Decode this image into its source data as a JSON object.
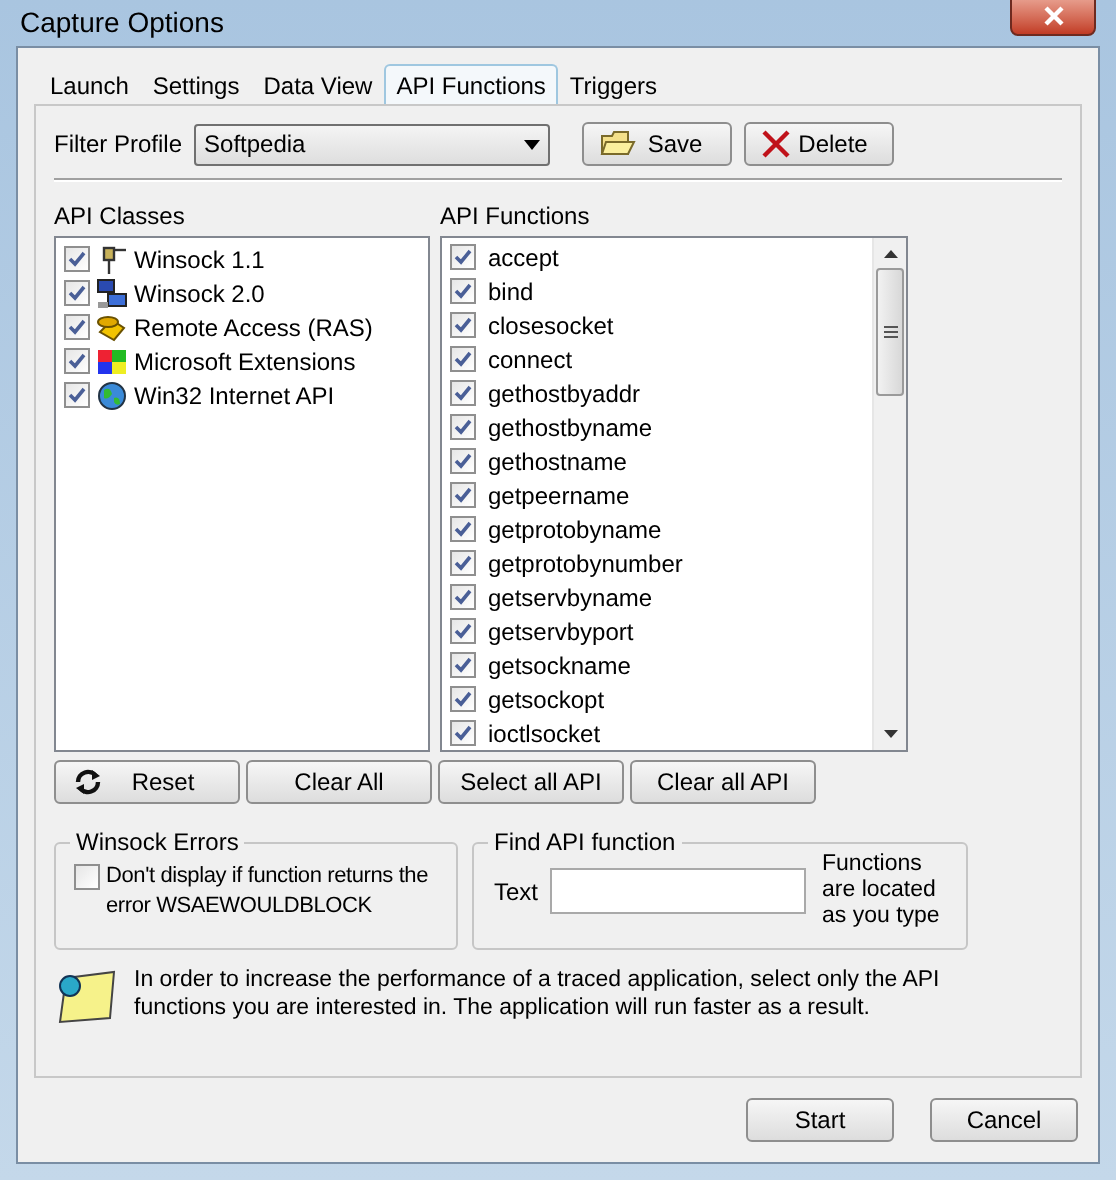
{
  "window": {
    "title": "Capture Options"
  },
  "tabs": [
    {
      "label": "Launch",
      "selected": false
    },
    {
      "label": "Settings",
      "selected": false
    },
    {
      "label": "Data View",
      "selected": false
    },
    {
      "label": "API Functions",
      "selected": true
    },
    {
      "label": "Triggers",
      "selected": false
    }
  ],
  "filter_profile": {
    "label": "Filter Profile",
    "value": "Softpedia",
    "save": "Save",
    "delete": "Delete"
  },
  "api_classes": {
    "label": "API Classes",
    "items": [
      {
        "label": "Winsock 1.1",
        "checked": true
      },
      {
        "label": "Winsock 2.0",
        "checked": true
      },
      {
        "label": "Remote Access (RAS)",
        "checked": true
      },
      {
        "label": "Microsoft Extensions",
        "checked": true
      },
      {
        "label": "Win32 Internet API",
        "checked": true
      }
    ]
  },
  "api_functions": {
    "label": "API Functions",
    "items": [
      {
        "label": "accept",
        "checked": true
      },
      {
        "label": "bind",
        "checked": true
      },
      {
        "label": "closesocket",
        "checked": true
      },
      {
        "label": "connect",
        "checked": true
      },
      {
        "label": "gethostbyaddr",
        "checked": true
      },
      {
        "label": "gethostbyname",
        "checked": true
      },
      {
        "label": "gethostname",
        "checked": true
      },
      {
        "label": "getpeername",
        "checked": true
      },
      {
        "label": "getprotobyname",
        "checked": true
      },
      {
        "label": "getprotobynumber",
        "checked": true
      },
      {
        "label": "getservbyname",
        "checked": true
      },
      {
        "label": "getservbyport",
        "checked": true
      },
      {
        "label": "getsockname",
        "checked": true
      },
      {
        "label": "getsockopt",
        "checked": true
      },
      {
        "label": "ioctlsocket",
        "checked": true
      }
    ]
  },
  "list_buttons": [
    "Reset",
    "Clear All",
    "Select all API",
    "Clear all API"
  ],
  "winsock_errors": {
    "title": "Winsock Errors",
    "option": {
      "label": "Don't display if function returns the error WSAEWOULDBLOCK",
      "checked": false
    }
  },
  "find_api": {
    "title": "Find API function",
    "field_label": "Text",
    "hint": "Functions are located as you type"
  },
  "info": "In order to increase the performance of a traced application, select only the API functions you are interested in. The application will run faster as a result.",
  "footer_buttons": [
    "Start",
    "Cancel"
  ]
}
